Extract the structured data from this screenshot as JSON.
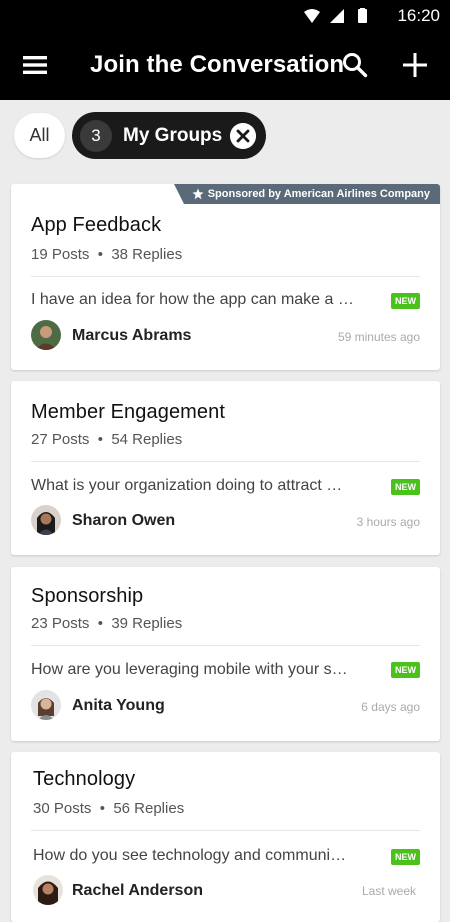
{
  "status_bar": {
    "time": "16:20"
  },
  "app_bar": {
    "title": "Join the Conversation"
  },
  "filters": {
    "all_label": "All",
    "groups_count": "3",
    "groups_label": "My Groups"
  },
  "colors": {
    "appbar_bg": "#000000",
    "new_badge": "#4bc21b",
    "sponsor_bg": "#5b6a79"
  },
  "groups": [
    {
      "title": "App Feedback",
      "posts": "19 Posts",
      "replies": "38 Replies",
      "sponsor": "Sponsored by American Airlines Company",
      "excerpt": "I have an idea for how the app can make a …",
      "badge": "NEW",
      "author": "Marcus Abrams",
      "time": "59 minutes ago"
    },
    {
      "title": "Member Engagement",
      "posts": "27 Posts",
      "replies": "54 Replies",
      "excerpt": "What is your organization doing to attract …",
      "badge": "NEW",
      "author": "Sharon Owen",
      "time": "3 hours ago"
    },
    {
      "title": "Sponsorship",
      "posts": "23 Posts",
      "replies": "39 Replies",
      "excerpt": "How are you leveraging mobile with your s…",
      "badge": "NEW",
      "author": "Anita Young",
      "time": "6 days ago"
    },
    {
      "title": "Technology",
      "posts": "30 Posts",
      "replies": "56 Replies",
      "excerpt": "How do you see technology and communi…",
      "badge": "NEW",
      "author": "Rachel Anderson",
      "time": "Last week"
    }
  ]
}
